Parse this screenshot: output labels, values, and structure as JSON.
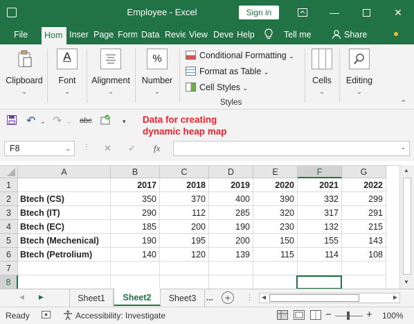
{
  "window": {
    "title": "Employee  -  Excel",
    "signin": "Sign in"
  },
  "tabs": [
    "File",
    "Hom",
    "Inser",
    "Page",
    "Form",
    "Data",
    "Revie",
    "View",
    "Deve",
    "Help",
    "Tell me",
    "Share"
  ],
  "ribbon": {
    "clipboard": "Clipboard",
    "font": "Font",
    "alignment": "Alignment",
    "number": "Number",
    "conditional": "Conditional Formatting",
    "format_table": "Format as Table",
    "cell_styles": "Cell Styles",
    "styles": "Styles",
    "cells": "Cells",
    "editing": "Editing"
  },
  "qat": {
    "undo_extra": "abc"
  },
  "note": [
    "Data for creating",
    "dynamic heap map"
  ],
  "formula": {
    "name_box": "F8",
    "fx": "fx",
    "value": ""
  },
  "grid": {
    "columns": [
      "A",
      "B",
      "C",
      "D",
      "E",
      "F",
      "G"
    ],
    "rows": [
      "1",
      "2",
      "3",
      "4",
      "5",
      "6",
      "7",
      "8"
    ],
    "header_years": [
      "2017",
      "2018",
      "2019",
      "2020",
      "2021",
      "2022"
    ],
    "data": [
      {
        "label": "Btech (CS)",
        "values": [
          "350",
          "370",
          "400",
          "390",
          "332",
          "299"
        ]
      },
      {
        "label": "Btech (IT)",
        "values": [
          "290",
          "112",
          "285",
          "320",
          "317",
          "291"
        ]
      },
      {
        "label": "Btech (EC)",
        "values": [
          "185",
          "200",
          "190",
          "230",
          "132",
          "215"
        ]
      },
      {
        "label": "Btech (Mechenical)",
        "values": [
          "190",
          "195",
          "200",
          "150",
          "155",
          "143"
        ]
      },
      {
        "label": "Btech (Petrolium)",
        "values": [
          "140",
          "120",
          "139",
          "115",
          "114",
          "108"
        ]
      }
    ]
  },
  "sheets": [
    "Sheet1",
    "Sheet2",
    "Sheet3"
  ],
  "sheets_more": "...",
  "status": {
    "ready": "Ready",
    "accessibility": "Accessibility: Investigate",
    "zoom": "100%"
  }
}
